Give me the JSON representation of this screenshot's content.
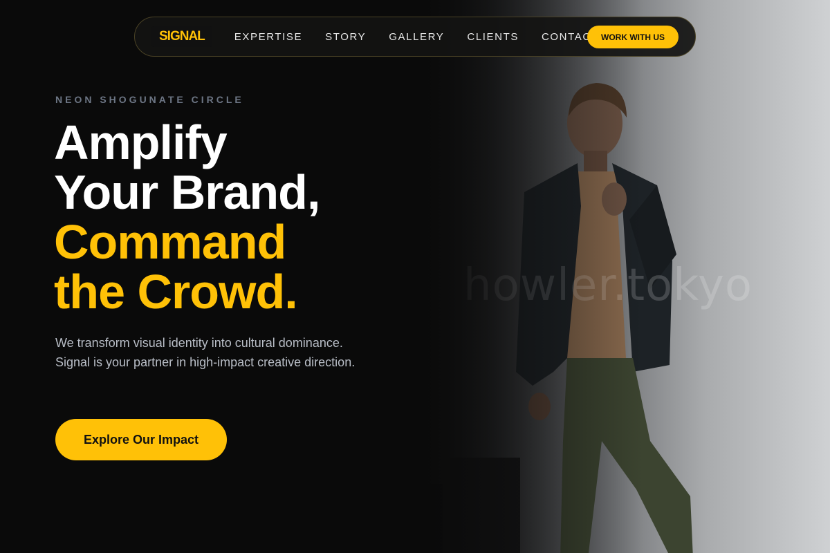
{
  "nav": {
    "logo": "SIGNAL",
    "links": [
      "EXPERTISE",
      "STORY",
      "GALLERY",
      "CLIENTS",
      "CONTACT"
    ],
    "cta": "WORK WITH US"
  },
  "hero": {
    "eyebrow": "NEON SHOGUNATE CIRCLE",
    "headline_white": [
      "Amplify",
      "Your Brand,"
    ],
    "headline_accent": [
      "Command",
      "the Crowd."
    ],
    "subtext": "We transform visual identity into cultural dominance. Signal is your partner in high-impact creative direction.",
    "cta": "Explore Our Impact",
    "photo_watermark": "howler.tokyo"
  },
  "colors": {
    "accent": "#ffc107",
    "background": "#0a0a0a",
    "eyebrow": "#6d7685",
    "body_text": "#b9bec7"
  }
}
